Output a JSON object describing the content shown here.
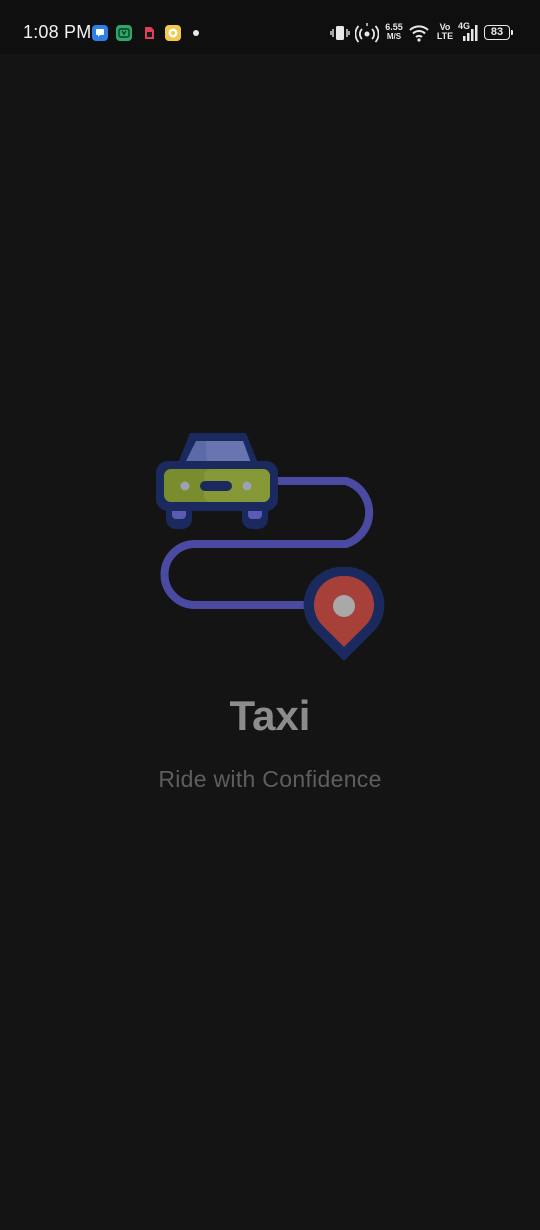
{
  "status_bar": {
    "time": "1:08 PM",
    "network_speed_value": "6.55",
    "network_speed_unit": "M/S",
    "volte_top": "Vo",
    "volte_bottom": "LTE",
    "network_type": "4G",
    "battery_level": "83",
    "notification_icons": [
      "messages-icon",
      "meet-icon",
      "sim-card-icon",
      "notes-icon"
    ]
  },
  "splash": {
    "title": "Taxi",
    "tagline": "Ride with Confidence"
  },
  "colors": {
    "background": "#141414",
    "title": "#8c8c8c",
    "tagline": "#5e5e5e",
    "route": "#4a4aa3",
    "car_body": "#7a8d2e",
    "car_outline": "#1a2a5e",
    "pin": "#a8403a"
  }
}
